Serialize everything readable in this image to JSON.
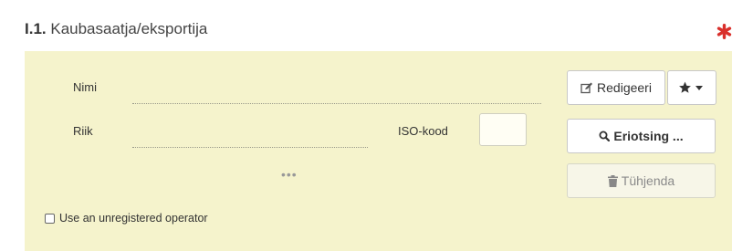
{
  "section": {
    "number": "I.1.",
    "title": "Kaubasaatja/eksportija"
  },
  "fields": {
    "name_label": "Nimi",
    "country_label": "Riik",
    "iso_label": "ISO-kood",
    "iso_value": "",
    "more_indicator": "•••"
  },
  "buttons": {
    "edit_label": "Redigeeri",
    "favorites_icon": "star-icon",
    "search_label": "Eriotsing ...",
    "clear_label": "Tühjenda"
  },
  "options": {
    "unregistered_label": "Use an unregistered operator",
    "unregistered_checked": false
  },
  "colors": {
    "panel_background": "#f5f3cc",
    "required_marker": "#d9302c"
  }
}
